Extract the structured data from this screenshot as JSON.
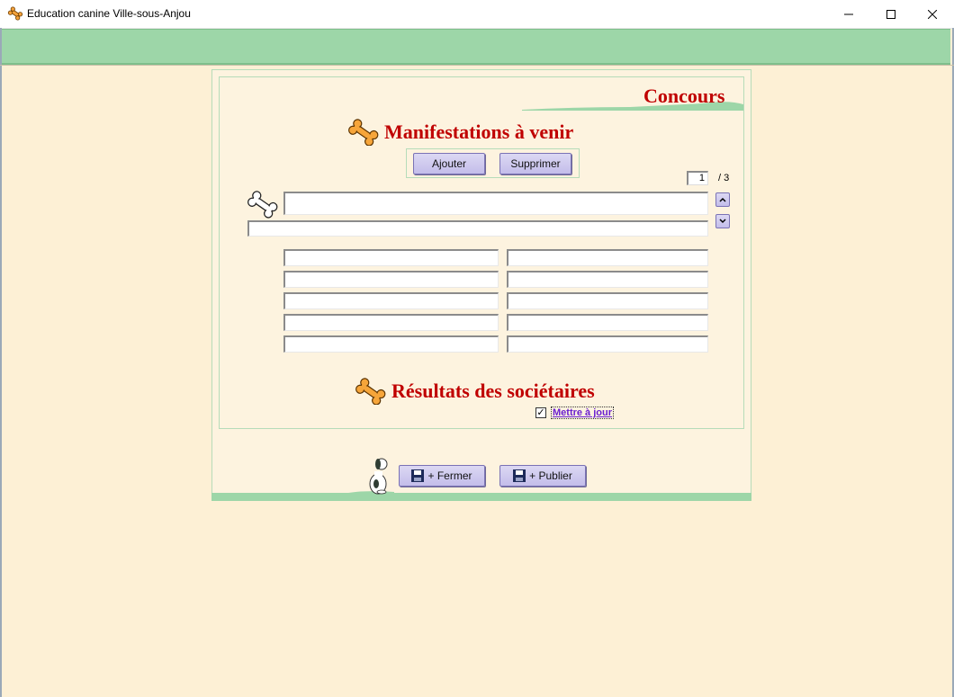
{
  "window": {
    "title": "Education canine Ville-sous-Anjou",
    "icon": "bone-icon",
    "controls": [
      "minimize-icon",
      "maximize-icon",
      "close-icon"
    ]
  },
  "panel": {
    "section_title": "Concours",
    "upcoming": {
      "heading": "Manifestations à venir",
      "add_label": "Ajouter",
      "delete_label": "Supprimer",
      "page_current": "1",
      "page_total": "/ 3"
    },
    "results": {
      "heading": "Résultats des sociétaires",
      "update_label": "Mettre à jour",
      "update_checked": true
    },
    "footer": {
      "close_label": "+  Fermer",
      "publish_label": "+  Publier"
    }
  },
  "colors": {
    "background": "#fdf0d5",
    "green_bar": "#9dd6a8",
    "heading_red": "#c00000",
    "button_violet": "#c3bdea"
  }
}
